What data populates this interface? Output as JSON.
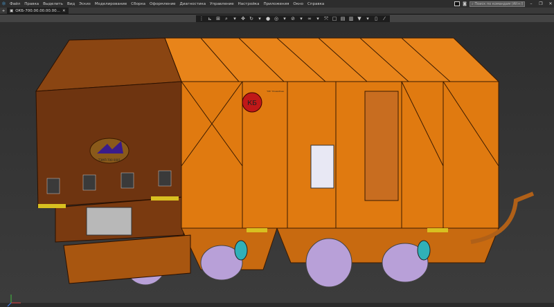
{
  "menu": {
    "items": [
      "Файл",
      "Правка",
      "Выделить",
      "Вид",
      "Эскиз",
      "Моделирование",
      "Сборка",
      "Оформление",
      "Диагностика",
      "Управление",
      "Настройка",
      "Приложения",
      "Окно",
      "Справка"
    ]
  },
  "search": {
    "placeholder": "Поиск по командам (Alt+/)"
  },
  "window_controls": {
    "minimize": "–",
    "restore": "❐",
    "close": "✕"
  },
  "tabs": [
    {
      "label": "ОКБ-700.00.00.00.00...",
      "close": "✕"
    }
  ],
  "new_tab": "+",
  "toolbar": {
    "icons": [
      "grip-icon",
      "orient-icon",
      "view-normal-icon",
      "zoom-icon",
      "dropdown",
      "pan-icon",
      "rotate-icon",
      "dropdown",
      "shaded-icon",
      "display-mode-icon",
      "dropdown",
      "section-icon",
      "dropdown",
      "hide-icon",
      "dropdown",
      "fit-icon",
      "window-icon",
      "layer-icon",
      "sheet-icon",
      "filter-icon",
      "dropdown",
      "properties-icon",
      "measure-icon"
    ]
  },
  "model": {
    "logo_text": "ТЭМП-700 0001",
    "badge_text": "КБ",
    "plate_text": "\"КБ\" Пламябоек"
  },
  "colors": {
    "body": "#e07a10",
    "body_dark": "#a85610",
    "cab": "#7a3a10",
    "background": "#353535"
  }
}
